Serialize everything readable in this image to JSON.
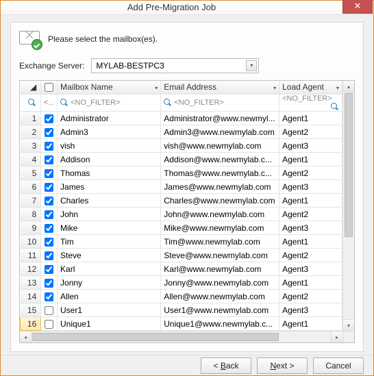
{
  "window": {
    "title": "Add Pre-Migration Job"
  },
  "prompt": "Please select the mailbox(es).",
  "server": {
    "label": "Exchange Server:",
    "value": "MYLAB-BESTPC3"
  },
  "columns": {
    "check_filter": "<...",
    "name": "Mailbox Name",
    "email": "Email Address",
    "agent": "Load Agent",
    "no_filter": "<NO_FILTER>"
  },
  "rows": [
    {
      "n": 1,
      "chk": true,
      "name": "Administrator",
      "email": "Administrator@www.newmyl...",
      "agent": "Agent1"
    },
    {
      "n": 2,
      "chk": true,
      "name": "Admin3",
      "email": "Admin3@www.newmylab.com",
      "agent": "Agent2"
    },
    {
      "n": 3,
      "chk": true,
      "name": "vish",
      "email": "vish@www.newmylab.com",
      "agent": "Agent3"
    },
    {
      "n": 4,
      "chk": true,
      "name": "Addison",
      "email": "Addison@www.newmylab.c...",
      "agent": "Agent1"
    },
    {
      "n": 5,
      "chk": true,
      "name": "Thomas",
      "email": "Thomas@www.newmylab.c...",
      "agent": "Agent2"
    },
    {
      "n": 6,
      "chk": true,
      "name": "James",
      "email": "James@www.newmylab.com",
      "agent": "Agent3"
    },
    {
      "n": 7,
      "chk": true,
      "name": "Charles",
      "email": "Charles@www.newmylab.com",
      "agent": "Agent1"
    },
    {
      "n": 8,
      "chk": true,
      "name": "John",
      "email": "John@www.newmylab.com",
      "agent": "Agent2"
    },
    {
      "n": 9,
      "chk": true,
      "name": "Mike",
      "email": "Mike@www.newmylab.com",
      "agent": "Agent3"
    },
    {
      "n": 10,
      "chk": true,
      "name": "Tim",
      "email": "Tim@www.newmylab.com",
      "agent": "Agent1"
    },
    {
      "n": 11,
      "chk": true,
      "name": "Steve",
      "email": "Steve@www.newmylab.com",
      "agent": "Agent2"
    },
    {
      "n": 12,
      "chk": true,
      "name": "Karl",
      "email": "Karl@www.newmylab.com",
      "agent": "Agent3"
    },
    {
      "n": 13,
      "chk": true,
      "name": "Jonny",
      "email": "Jonny@www.newmylab.com",
      "agent": "Agent1"
    },
    {
      "n": 14,
      "chk": true,
      "name": "Allen",
      "email": "Allen@www.newmylab.com",
      "agent": "Agent2"
    },
    {
      "n": 15,
      "chk": false,
      "name": "User1",
      "email": "User1@www.newmylab.com",
      "agent": "Agent3"
    },
    {
      "n": 16,
      "chk": false,
      "name": "Unique1",
      "email": "Unique1@www.newmylab.c...",
      "agent": "Agent1"
    }
  ],
  "buttons": {
    "back": "Back",
    "next": "Next",
    "cancel": "Cancel"
  }
}
